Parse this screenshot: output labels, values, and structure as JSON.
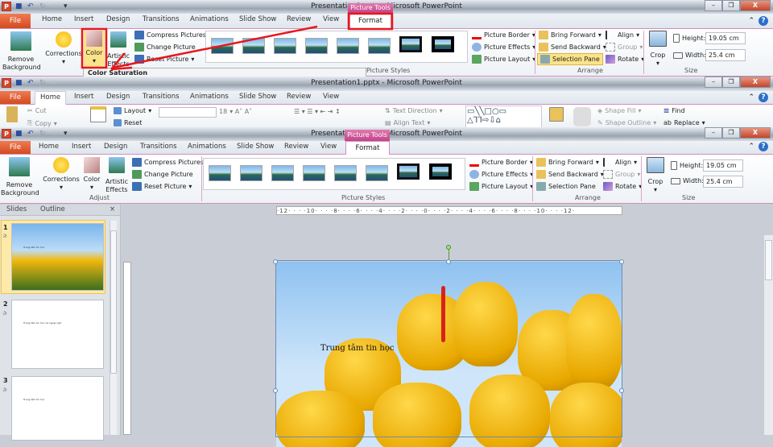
{
  "window": {
    "title": "Presentation1.pptx - Microsoft PowerPoint",
    "app_letter": "P",
    "minimize": "–",
    "restore": "❐",
    "close": "X",
    "help": "?"
  },
  "tabs": {
    "file": "File",
    "home": "Home",
    "insert": "Insert",
    "design": "Design",
    "transitions": "Transitions",
    "animations": "Animations",
    "slideshow": "Slide Show",
    "review": "Review",
    "view": "View",
    "context_group": "Picture Tools",
    "format": "Format"
  },
  "format_ribbon": {
    "remove_background": "Remove Background",
    "corrections": "Corrections",
    "color": "Color",
    "artistic_effects": "Artistic Effects",
    "compress_pictures": "Compress Pictures",
    "change_picture": "Change Picture",
    "reset_picture": "Reset Picture",
    "adjust_label": "Adjust",
    "picture_styles_label": "Picture Styles",
    "picture_border": "Picture Border",
    "picture_effects": "Picture Effects",
    "picture_layout": "Picture Layout",
    "bring_forward": "Bring Forward",
    "send_backward": "Send Backward",
    "selection_pane": "Selection Pane",
    "align": "Align",
    "group": "Group",
    "rotate": "Rotate",
    "arrange_label": "Arrange",
    "crop": "Crop",
    "height_label": "Height:",
    "height_value": "19.05 cm",
    "width_label": "Width:",
    "width_value": "25.4 cm",
    "size_label": "Size"
  },
  "tooltip": "Color Saturation",
  "home_ribbon": {
    "cut": "Cut",
    "copy": "Copy",
    "layout": "Layout",
    "reset": "Reset",
    "font_size": "18",
    "text_direction": "Text Direction",
    "align_text": "Align Text",
    "shape_fill": "Shape Fill",
    "shape_outline": "Shape Outline",
    "find": "Find",
    "replace": "Replace"
  },
  "slides_pane": {
    "tab_slides": "Slides",
    "tab_outline": "Outline",
    "close": "×",
    "slides": [
      {
        "number": "1",
        "text": "Trung tâm tin học"
      },
      {
        "number": "2",
        "text": "Trung tâm tin học và ngoại ngữ"
      },
      {
        "number": "3",
        "text": "Trung tâm tin học"
      }
    ]
  },
  "ruler": {
    "horizontal": "·12· · · ·10· · · ·8· · · ·6· · · ·4· · · ·2· · · ·0· · · ·2· · · ·4· · · ·6· · · ·8· · · ·10· · · ·12·"
  },
  "slide": {
    "text": "Trung  tâm tin học"
  },
  "colors": {
    "accent": "#c0458a",
    "annotation": "#e8161c",
    "file_tab": "#d34a1f"
  }
}
